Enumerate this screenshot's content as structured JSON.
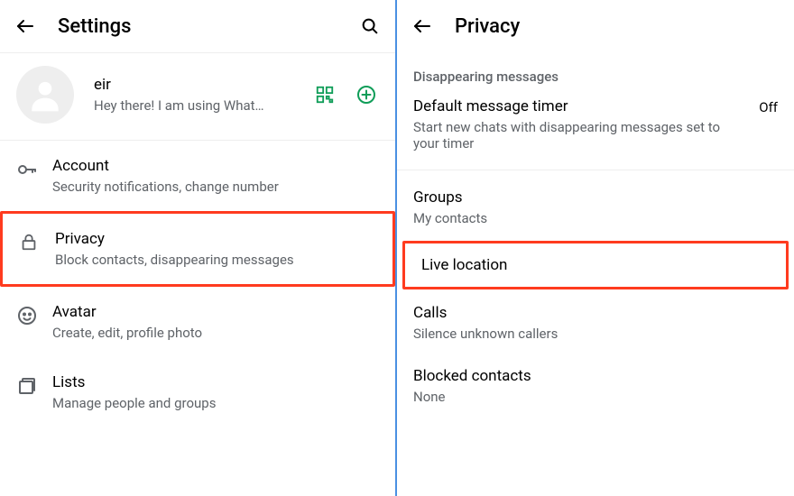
{
  "left": {
    "title": "Settings",
    "profile": {
      "name": "eir",
      "status": "Hey there! I am using What…"
    },
    "items": [
      {
        "title": "Account",
        "sub": "Security notifications, change number"
      },
      {
        "title": "Privacy",
        "sub": "Block contacts, disappearing messages"
      },
      {
        "title": "Avatar",
        "sub": "Create, edit, profile photo"
      },
      {
        "title": "Lists",
        "sub": "Manage people and groups"
      }
    ]
  },
  "right": {
    "title": "Privacy",
    "section_header": "Disappearing messages",
    "timer": {
      "title": "Default message timer",
      "sub": "Start new chats with disappearing messages set to your timer",
      "value": "Off"
    },
    "groups": {
      "title": "Groups",
      "sub": "My contacts"
    },
    "live_location": {
      "title": "Live location"
    },
    "calls": {
      "title": "Calls",
      "sub": "Silence unknown callers"
    },
    "blocked": {
      "title": "Blocked contacts",
      "sub": "None"
    }
  }
}
